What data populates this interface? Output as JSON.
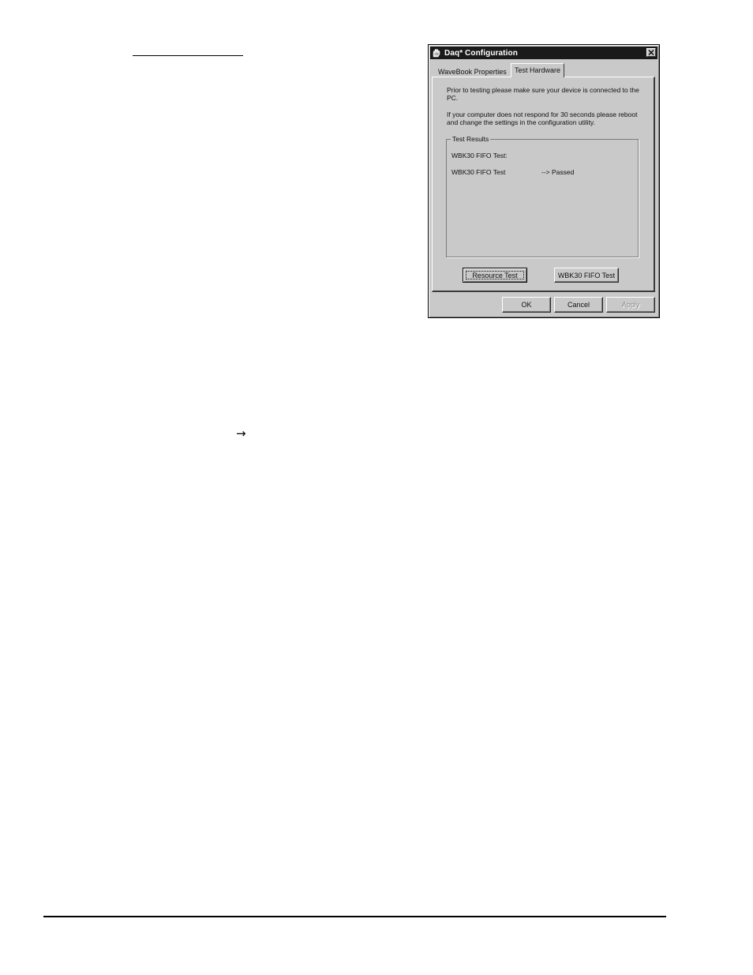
{
  "document": {
    "arrow_glyph": "→"
  },
  "dialog": {
    "title": "Daq* Configuration",
    "tabs": [
      {
        "label": "WaveBook Properties",
        "active": false
      },
      {
        "label": "Test Hardware",
        "active": true
      }
    ],
    "info_1": "Prior to testing please make sure your device is connected to the PC.",
    "info_2": "If your computer does not respond for 30 seconds please reboot and change the settings in the configuration utility.",
    "test_results": {
      "group_label": "Test Results",
      "rows": [
        {
          "label": "WBK30 FIFO Test:",
          "status": ""
        },
        {
          "label": "WBK30 FIFO Test",
          "status": "--> Passed"
        }
      ]
    },
    "buttons": {
      "resource_test": "Resource Test",
      "fifo_test": "WBK30 FIFO Test",
      "ok": "OK",
      "cancel": "Cancel",
      "apply": "Apply"
    },
    "icons": {
      "app": "hand-app-icon",
      "close": "close-icon"
    },
    "colors": {
      "face": "#c9c9c9",
      "titlebar": "#1a1a1a"
    }
  }
}
